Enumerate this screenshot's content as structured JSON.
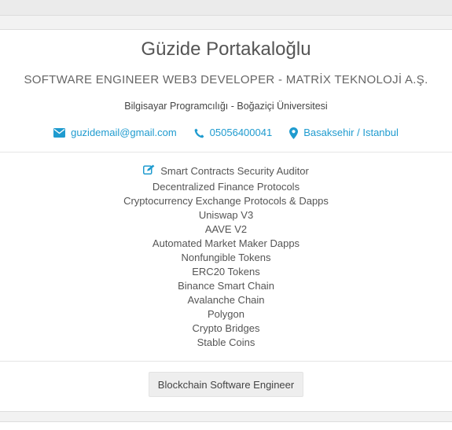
{
  "profile": {
    "name": "Güzide Portakaloğlu",
    "title": "SOFTWARE ENGINEER WEB3 DEVELOPER - MATRİX TEKNOLOJİ A.Ş.",
    "education": "Bilgisayar Programcılığı - Boğaziçi Üniversitesi"
  },
  "contacts": {
    "email": "guzidemail@gmail.com",
    "phone": "05056400041",
    "location": "Basaksehir / Istanbul"
  },
  "skills": {
    "heading": "Smart Contracts Security Auditor",
    "items": [
      "Decentralized Finance Protocols",
      "Cryptocurrency Exchange Protocols & Dapps",
      "Uniswap V3",
      "AAVE V2",
      "Automated Market Maker Dapps",
      "Nonfungible Tokens",
      "ERC20 Tokens",
      "Binance Smart Chain",
      "Avalanche Chain",
      "Polygon",
      "Crypto Bridges",
      "Stable Coins"
    ]
  },
  "role": {
    "label": "Blockchain Software Engineer"
  },
  "colors": {
    "accent": "#1f9bcf",
    "text": "#555555",
    "page_bg": "#f2f2f2"
  },
  "icons": {
    "email": "envelope-icon",
    "phone": "phone-icon",
    "location": "map-marker-icon",
    "skills": "edit-icon"
  }
}
